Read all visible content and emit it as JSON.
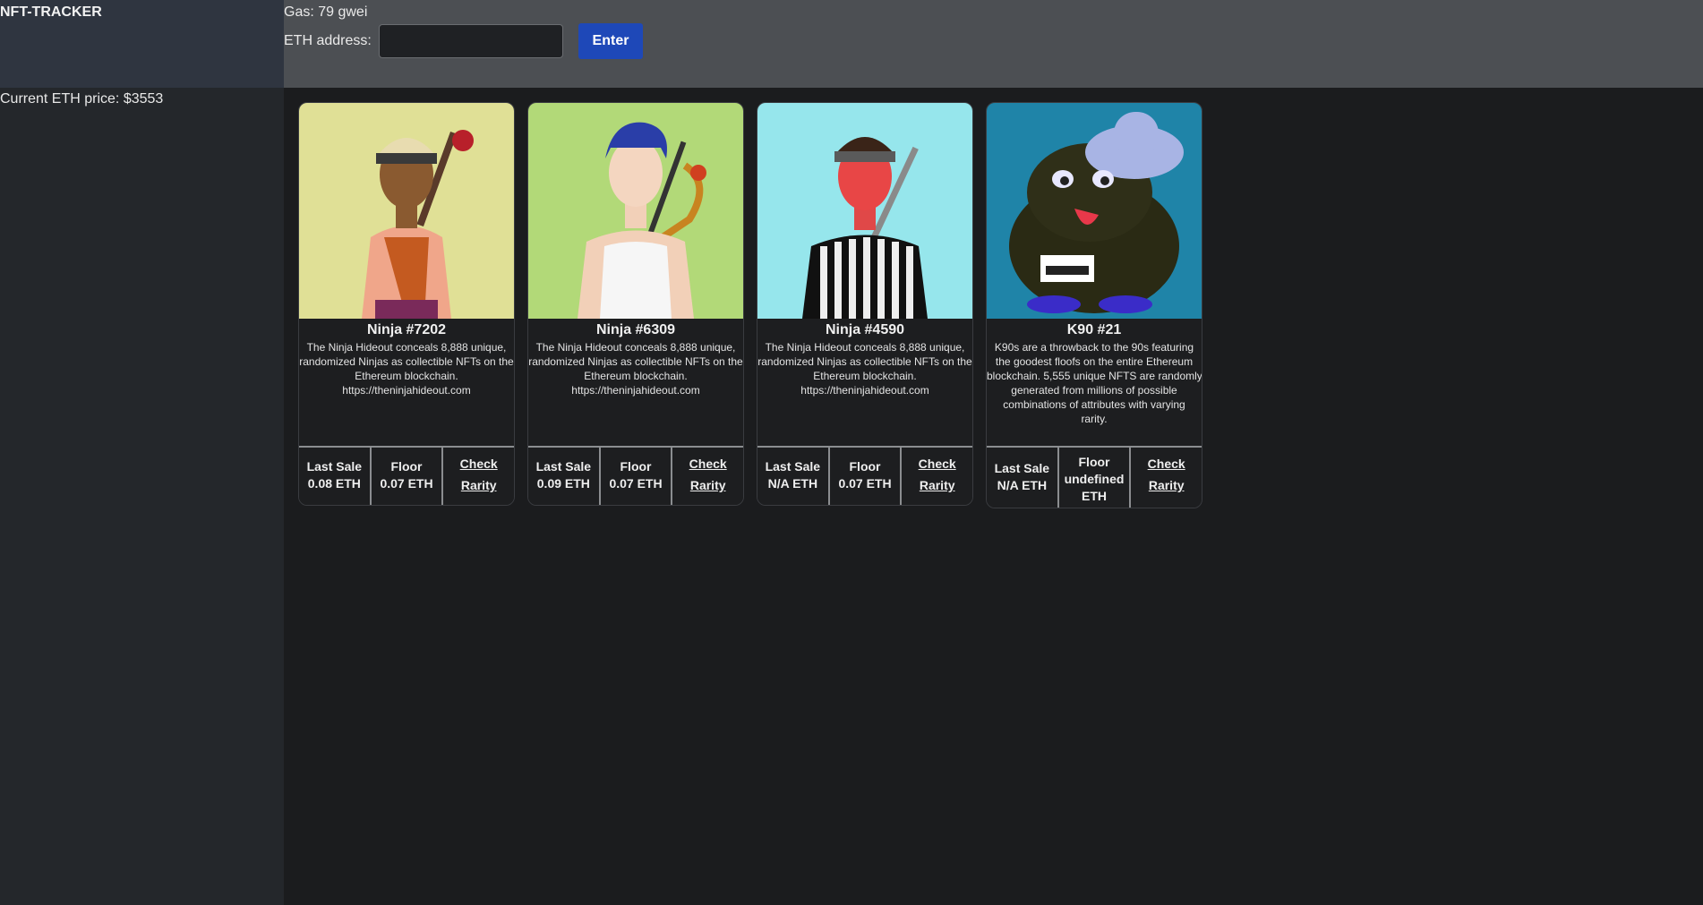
{
  "sidebar": {
    "brand": "NFT-TRACKER",
    "eth_price": "Current ETH price: $3553"
  },
  "topbar": {
    "gas": "Gas: 79 gwei",
    "address_label": "ETH address:",
    "address_value": "",
    "enter_label": "Enter"
  },
  "cards": [
    {
      "title": "Ninja #7202",
      "desc_lines": [
        "The Ninja Hideout conceals 8,888 unique,",
        "randomized Ninjas as collectible NFTs on the",
        "Ethereum blockchain.",
        "https://theninjahideout.com"
      ],
      "last_sale_label": "Last Sale",
      "last_sale_value": "0.08 ETH",
      "floor_label": "Floor",
      "floor_value": "0.07 ETH",
      "rarity_line1": "Check",
      "rarity_line2": "Rarity",
      "bg_color": "#e0e096"
    },
    {
      "title": "Ninja #6309",
      "desc_lines": [
        "The Ninja Hideout conceals 8,888 unique,",
        "randomized Ninjas as collectible NFTs on the",
        "Ethereum blockchain.",
        "https://theninjahideout.com"
      ],
      "last_sale_label": "Last Sale",
      "last_sale_value": "0.09 ETH",
      "floor_label": "Floor",
      "floor_value": "0.07 ETH",
      "rarity_line1": "Check",
      "rarity_line2": "Rarity",
      "bg_color": "#b2d978"
    },
    {
      "title": "Ninja #4590",
      "desc_lines": [
        "The Ninja Hideout conceals 8,888 unique,",
        "randomized Ninjas as collectible NFTs on the",
        "Ethereum blockchain.",
        "https://theninjahideout.com"
      ],
      "last_sale_label": "Last Sale",
      "last_sale_value": "N/A ETH",
      "floor_label": "Floor",
      "floor_value": "0.07 ETH",
      "rarity_line1": "Check",
      "rarity_line2": "Rarity",
      "bg_color": "#96e6ec"
    },
    {
      "title": "K90 #21",
      "desc_lines": [
        "K90s are a throwback to the 90s featuring",
        "the goodest floofs on the entire Ethereum",
        "blockchain. 5,555 unique NFTS are randomly",
        "generated from millions of possible",
        "combinations of attributes with varying",
        "rarity."
      ],
      "last_sale_label": "Last Sale",
      "last_sale_value": "N/A ETH",
      "floor_label": "Floor",
      "floor_value_line1": "undefined",
      "floor_value_line2": "ETH",
      "rarity_line1": "Check",
      "rarity_line2": "Rarity",
      "bg_color": "#1f84a8"
    }
  ]
}
